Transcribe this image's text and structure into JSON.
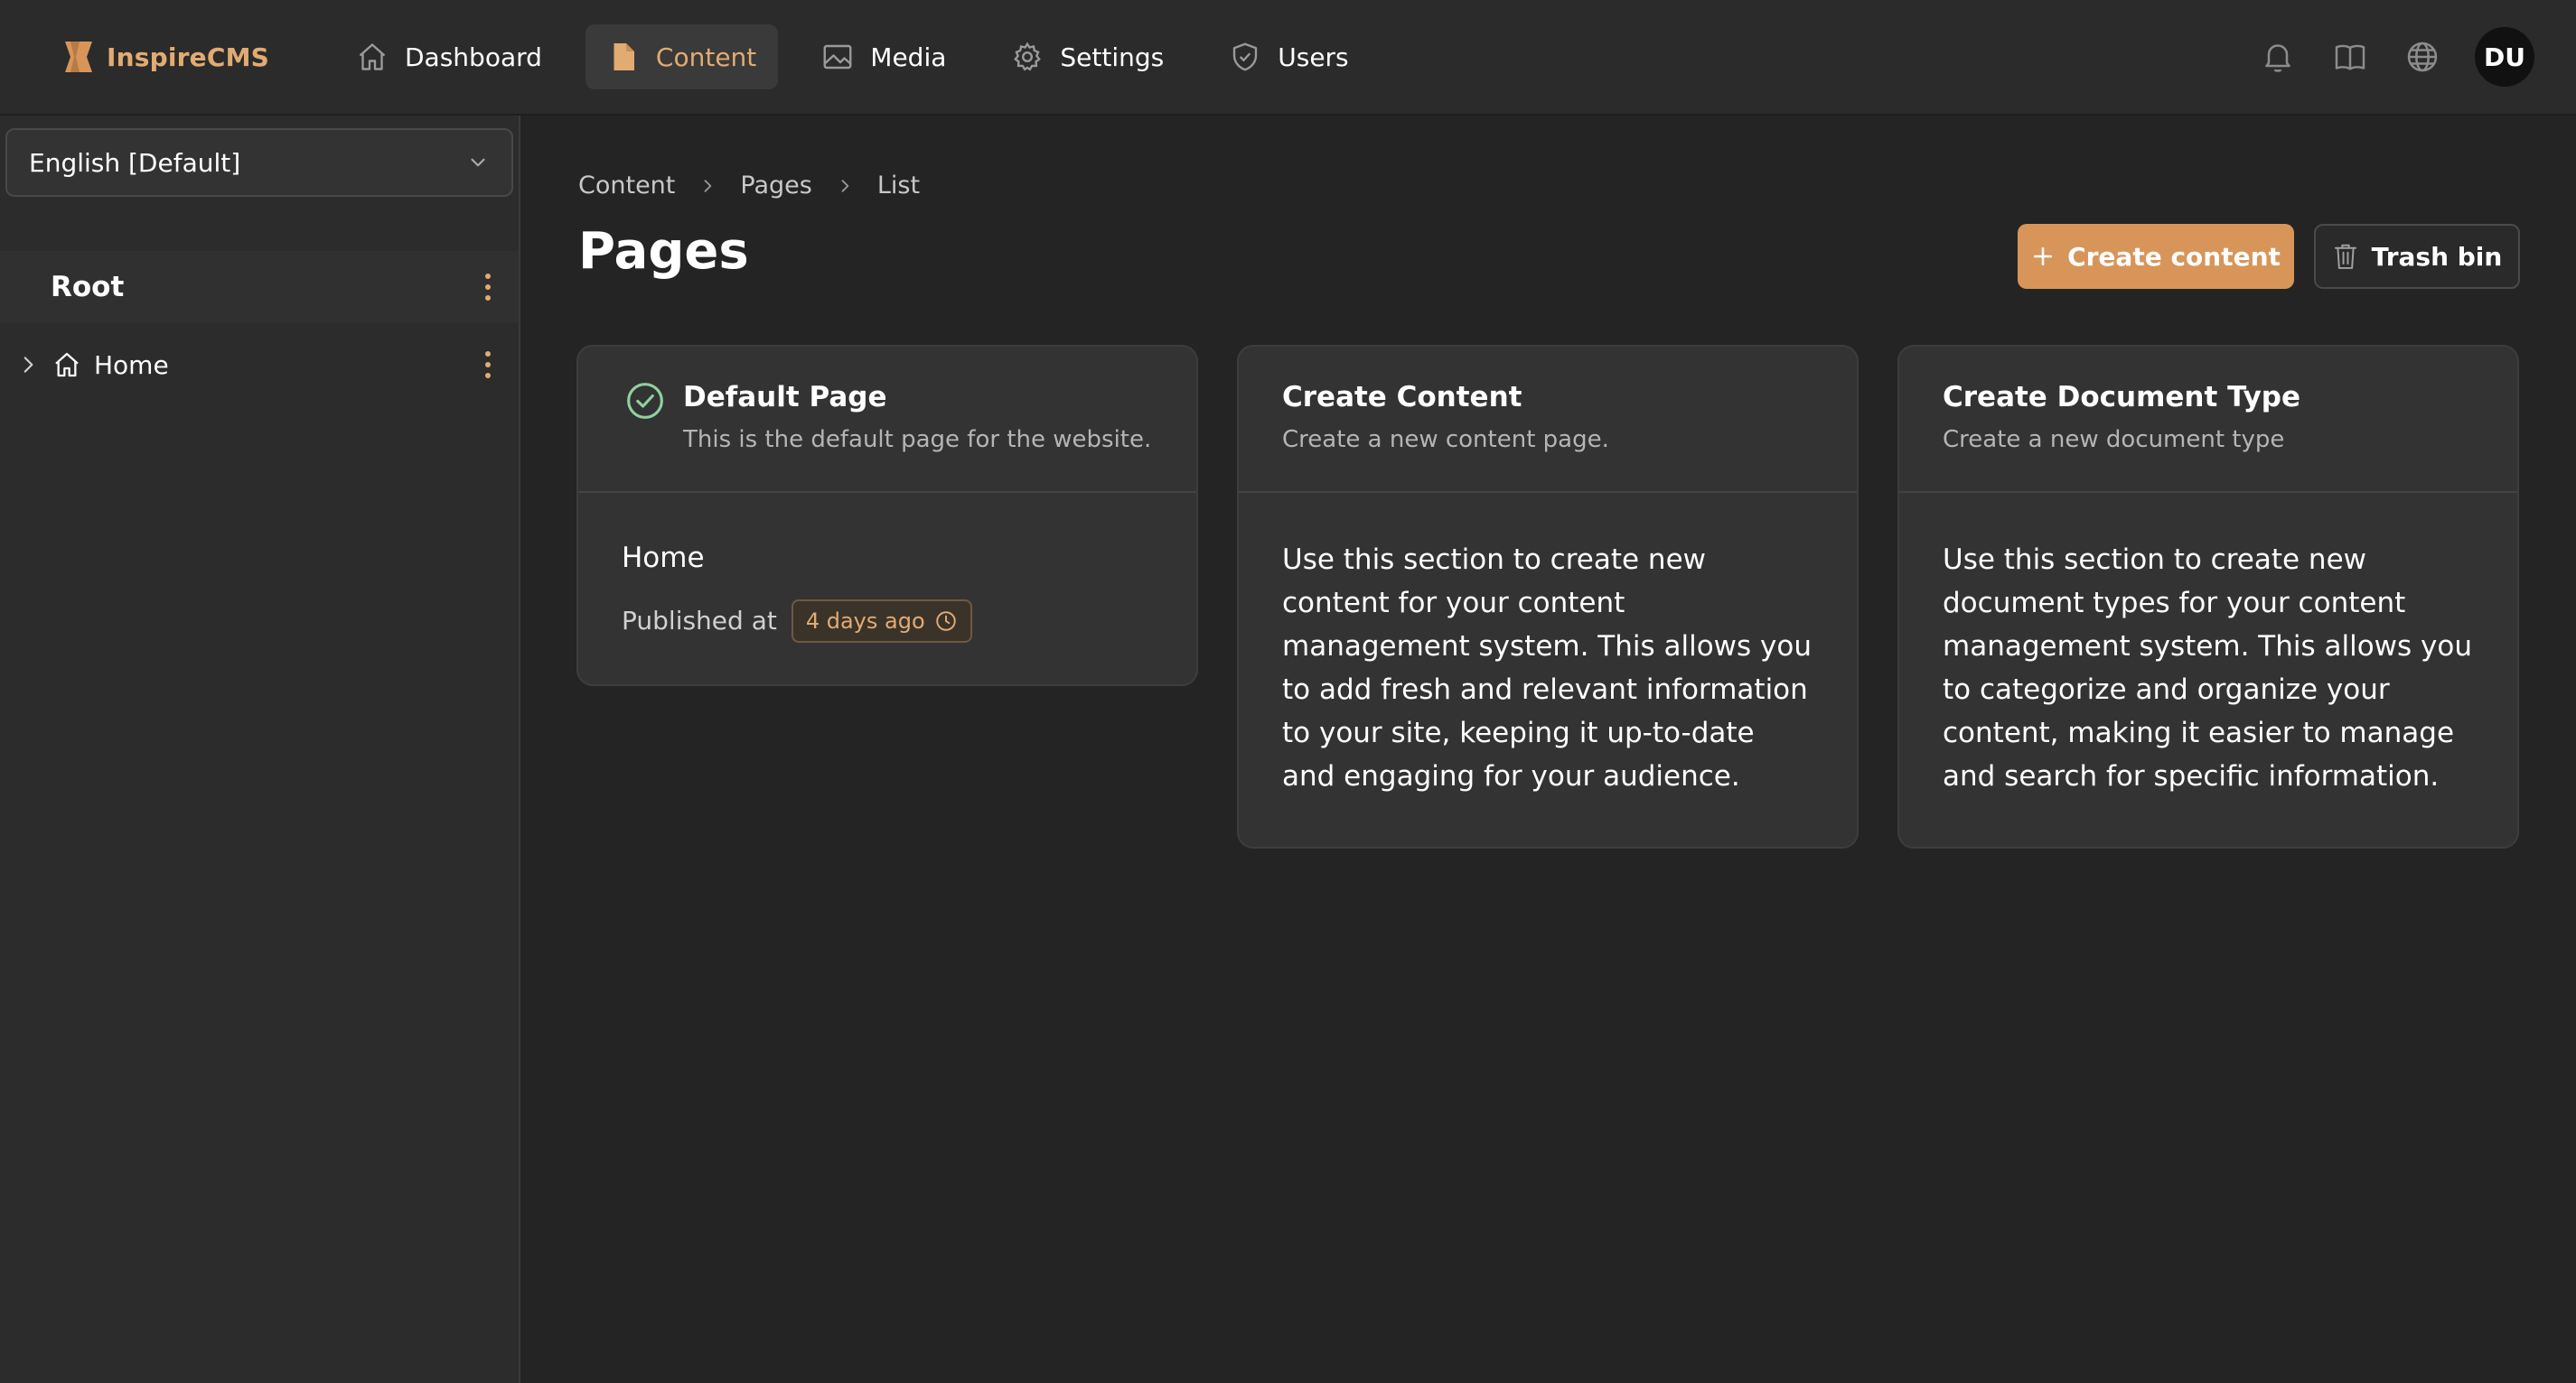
{
  "app": {
    "name": "InspireCMS",
    "accent": "#e2ab72",
    "primary_button_color": "#d8955a"
  },
  "nav": {
    "items": [
      {
        "label": "Dashboard",
        "icon": "home-icon",
        "active": false
      },
      {
        "label": "Content",
        "icon": "document-icon",
        "active": true
      },
      {
        "label": "Media",
        "icon": "image-icon",
        "active": false
      },
      {
        "label": "Settings",
        "icon": "gear-icon",
        "active": false
      },
      {
        "label": "Users",
        "icon": "shield-check-icon",
        "active": false
      }
    ]
  },
  "top_actions": {
    "icons": [
      "bell-icon",
      "book-icon",
      "globe-icon"
    ],
    "avatar_initials": "DU"
  },
  "sidebar": {
    "language": "English [Default]",
    "root_label": "Root",
    "nodes": [
      {
        "label": "Home",
        "icon": "home-icon"
      }
    ]
  },
  "main": {
    "breadcrumb": [
      "Content",
      "Pages",
      "List"
    ],
    "title": "Pages",
    "create_button": "Create content",
    "trash_button": "Trash bin",
    "cards": [
      {
        "title": "Default Page",
        "subtitle": "This is the default page for the website.",
        "page_name": "Home",
        "published_label": "Published at",
        "published_badge": "4 days ago"
      },
      {
        "title": "Create Content",
        "subtitle": "Create a new content page.",
        "body": "Use this section to create new content for your content management system. This allows you to add fresh and relevant information to your site, keeping it up-to-date and engaging for your audience."
      },
      {
        "title": "Create Document Type",
        "subtitle": "Create a new document type",
        "body": "Use this section to create new document types for your content management system. This allows you to categorize and organize your content, making it easier to manage and search for specific information."
      }
    ]
  }
}
